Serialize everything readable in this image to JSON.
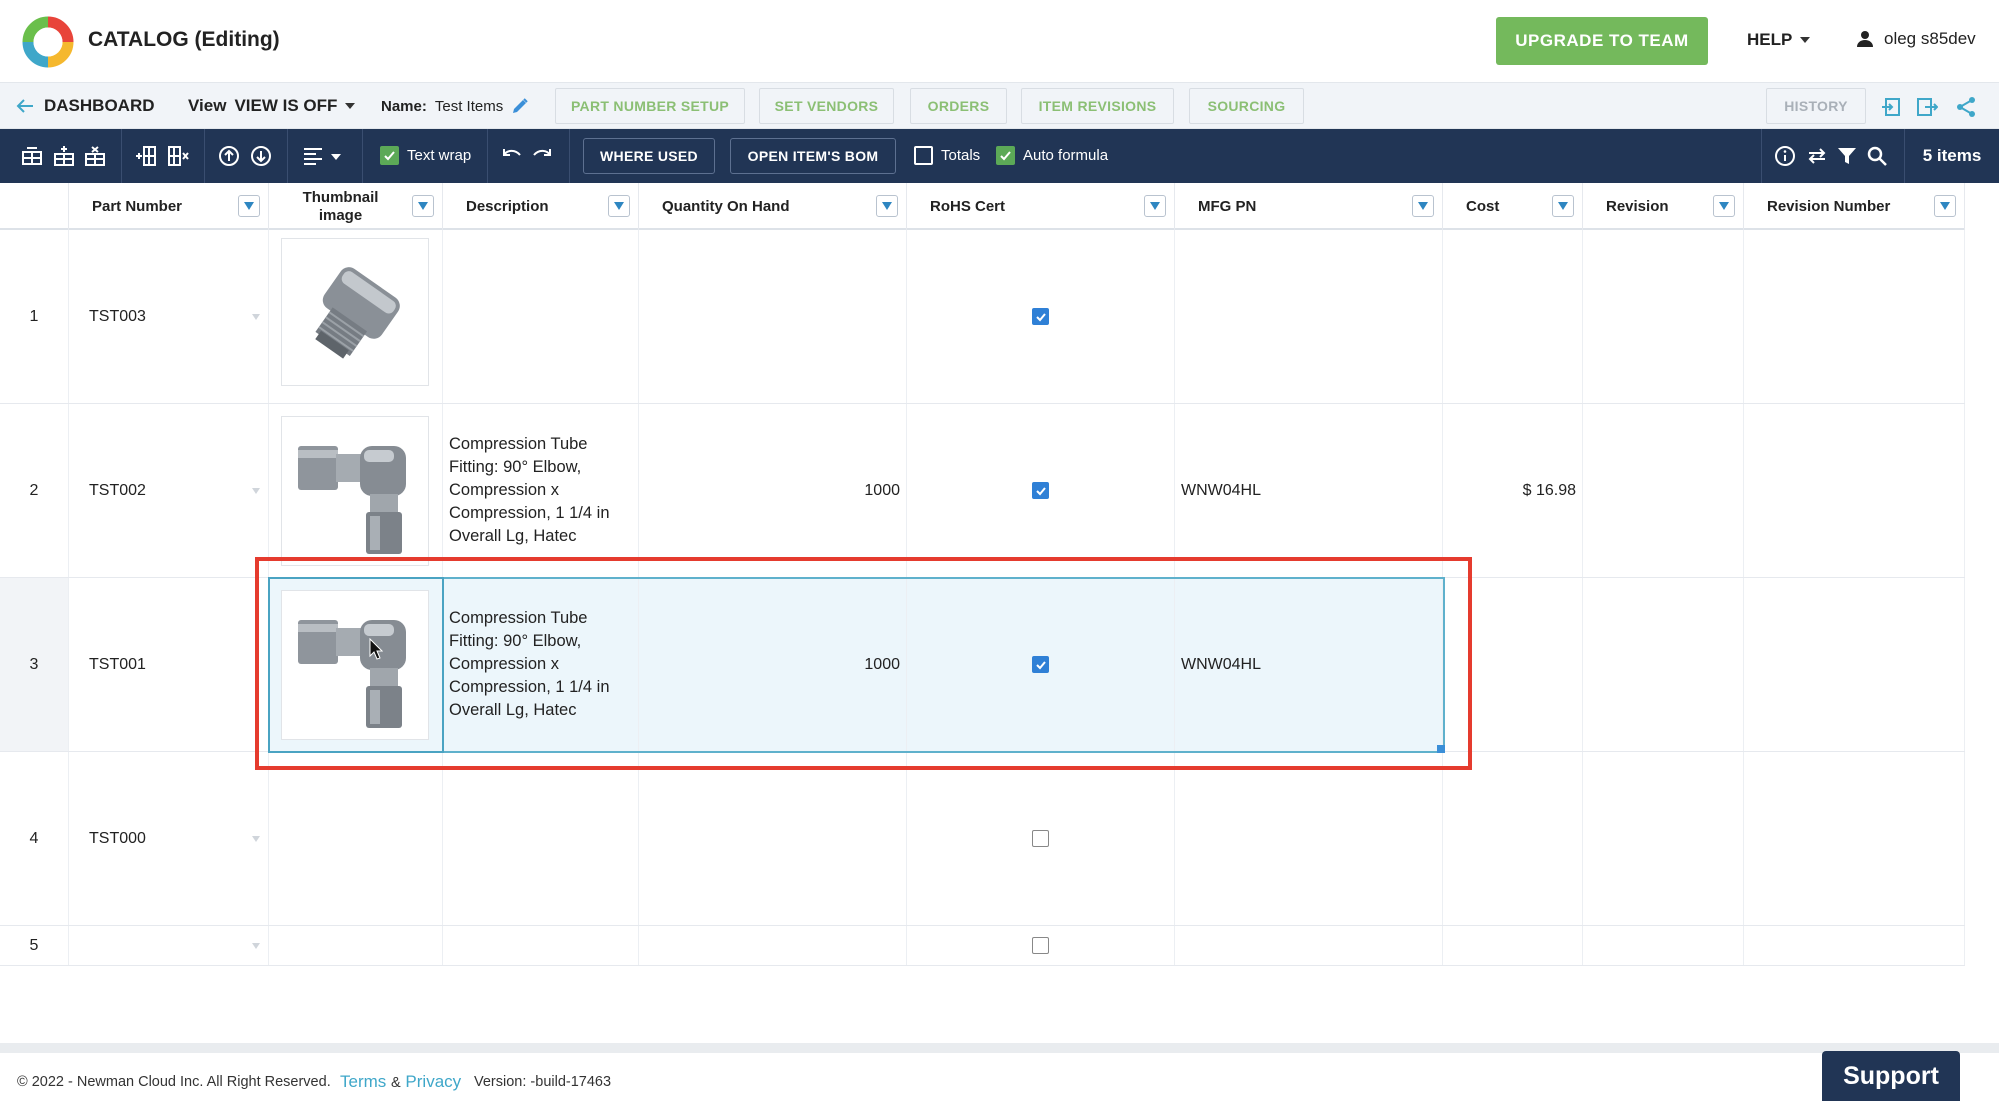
{
  "header": {
    "app_title": "CATALOG (Editing)",
    "upgrade_label": "UPGRADE TO TEAM",
    "help_label": "HELP",
    "user_name": "oleg s85dev",
    "colors": {
      "upgrade": "#74b95c",
      "toolbar": "#213555"
    }
  },
  "nav": {
    "back_label": "DASHBOARD",
    "view_label": "View",
    "view_value": "VIEW IS OFF",
    "name_label": "Name:",
    "name_value": "Test Items",
    "tabs": [
      "PART NUMBER SETUP",
      "SET VENDORS",
      "ORDERS",
      "ITEM REVISIONS",
      "SOURCING"
    ],
    "history_label": "HISTORY"
  },
  "toolbar": {
    "text_wrap_label": "Text wrap",
    "text_wrap_checked": true,
    "where_used_label": "WHERE USED",
    "open_bom_label": "OPEN ITEM'S BOM",
    "totals_label": "Totals",
    "totals_checked": false,
    "auto_formula_label": "Auto formula",
    "auto_formula_checked": true,
    "items_count": "5 items"
  },
  "grid": {
    "columns": [
      "Part Number",
      "Thumbnail image",
      "Description",
      "Quantity On Hand",
      "RoHS Cert",
      "MFG PN",
      "Cost",
      "Revision",
      "Revision Number"
    ],
    "rows": [
      {
        "num": "1",
        "part_number": "TST003",
        "thumbnail": "straight-fitting",
        "description": "",
        "quantity": "",
        "rohs": true,
        "mfg_pn": "",
        "cost": "",
        "revision": "",
        "revision_number": ""
      },
      {
        "num": "2",
        "part_number": "TST002",
        "thumbnail": "elbow-fitting",
        "description": "Compression Tube Fitting: 90° Elbow, Compression x Compression, 1 1/4 in Overall Lg, Hatec",
        "quantity": "1000",
        "rohs": true,
        "mfg_pn": "WNW04HL",
        "cost": "$ 16.98",
        "revision": "",
        "revision_number": ""
      },
      {
        "num": "3",
        "part_number": "TST001",
        "thumbnail": "elbow-fitting",
        "description": "Compression Tube Fitting: 90° Elbow, Compression x Compression, 1 1/4 in Overall Lg, Hatec",
        "quantity": "1000",
        "rohs": true,
        "mfg_pn": "WNW04HL",
        "cost": "",
        "revision": "",
        "revision_number": ""
      },
      {
        "num": "4",
        "part_number": "TST000",
        "thumbnail": "",
        "description": "",
        "quantity": "",
        "rohs": false,
        "mfg_pn": "",
        "cost": "",
        "revision": "",
        "revision_number": ""
      },
      {
        "num": "5",
        "part_number": "",
        "thumbnail": "",
        "description": "",
        "quantity": "",
        "rohs": false,
        "mfg_pn": "",
        "cost": "",
        "revision": "",
        "revision_number": ""
      }
    ],
    "selected_row": "3"
  },
  "footer": {
    "copyright": "© 2022 - Newman Cloud Inc. All Right Reserved.",
    "terms_label": "Terms",
    "amp": "&",
    "privacy_label": "Privacy",
    "version": "Version: -build-17463",
    "support_label": "Support"
  }
}
